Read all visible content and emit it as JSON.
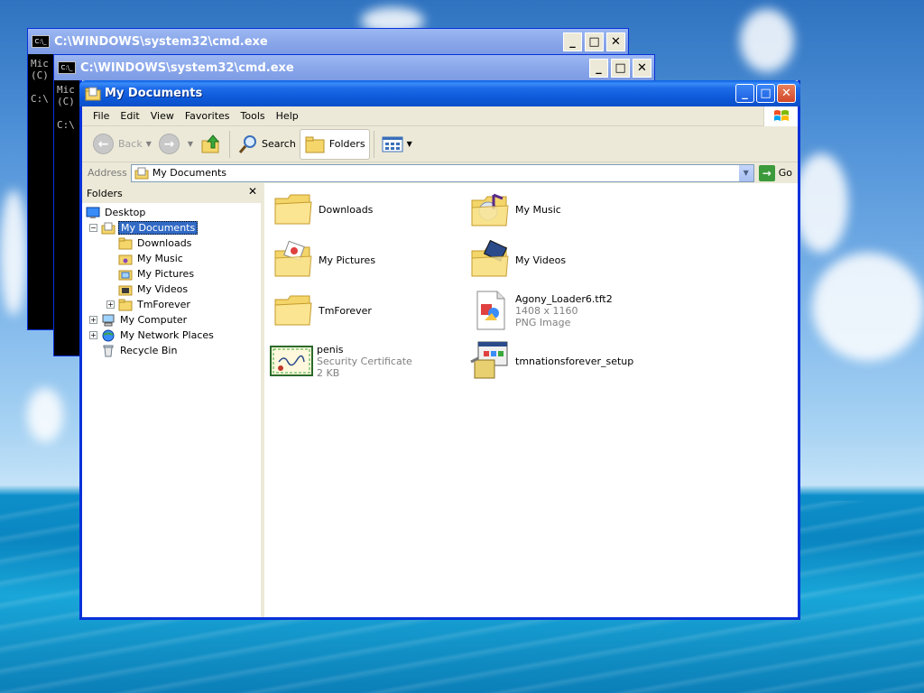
{
  "cmd_back": {
    "title": "C:\\WINDOWS\\system32\\cmd.exe",
    "icon_text": "C:\\_",
    "lines": [
      "Mic",
      "(C)",
      "",
      "C:\\"
    ]
  },
  "cmd_front": {
    "title": "C:\\WINDOWS\\system32\\cmd.exe",
    "icon_text": "C:\\_",
    "lines": [
      "Mic",
      "(C)",
      "",
      "C:\\"
    ]
  },
  "explorer": {
    "title": "My Documents",
    "menu": [
      "File",
      "Edit",
      "View",
      "Favorites",
      "Tools",
      "Help"
    ],
    "toolbar": {
      "back_label": "Back",
      "search_label": "Search",
      "folders_label": "Folders"
    },
    "address": {
      "label": "Address",
      "value": "My Documents",
      "go_label": "Go"
    },
    "folders_pane": {
      "header": "Folders",
      "tree": [
        {
          "label": "Desktop"
        },
        {
          "label": "My Documents"
        },
        {
          "label": "Downloads"
        },
        {
          "label": "My Music"
        },
        {
          "label": "My Pictures"
        },
        {
          "label": "My Videos"
        },
        {
          "label": "TmForever"
        },
        {
          "label": "My Computer"
        },
        {
          "label": "My Network Places"
        },
        {
          "label": "Recycle Bin"
        }
      ]
    },
    "files": [
      {
        "name": "Downloads",
        "line2": "",
        "line3": ""
      },
      {
        "name": "My Music",
        "line2": "",
        "line3": ""
      },
      {
        "name": "My Pictures",
        "line2": "",
        "line3": ""
      },
      {
        "name": "My Videos",
        "line2": "",
        "line3": ""
      },
      {
        "name": "TmForever",
        "line2": "",
        "line3": ""
      },
      {
        "name": "Agony_Loader6.tft2",
        "line2": "1408 x 1160",
        "line3": "PNG Image"
      },
      {
        "name": "penis",
        "line2": "Security Certificate",
        "line3": "2 KB"
      },
      {
        "name": "tmnationsforever_setup",
        "line2": "",
        "line3": ""
      }
    ]
  }
}
